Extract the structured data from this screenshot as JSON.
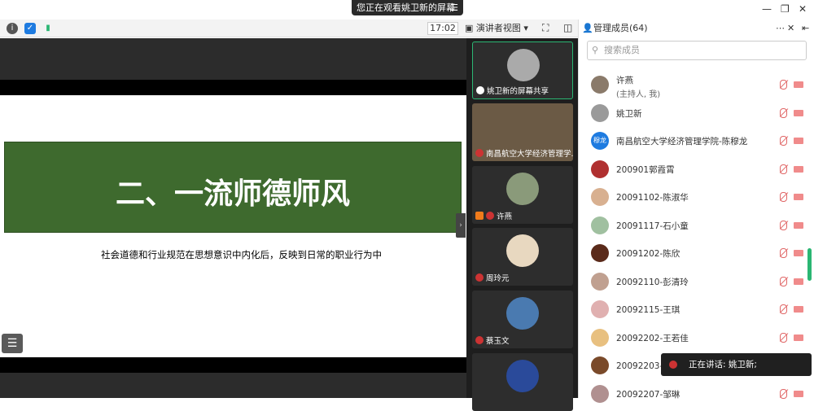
{
  "share_bar": {
    "text": "您正在观看姚卫新的屏幕",
    "menu_icon": "menu-icon"
  },
  "toolbar": {
    "time": "17:02",
    "view_mode": "演讲者视图"
  },
  "slide": {
    "title": "二、一流师德师风",
    "subtitle": "社会道德和行业规范在思想意识中内化后，反映到日常的职业行为中",
    "title_bg": "#3e6a2e"
  },
  "video_tiles": [
    {
      "label": "姚卫新的屏幕共享"
    },
    {
      "label": "南昌航空大学经济管理学..."
    },
    {
      "label": "许燕"
    },
    {
      "label": "周玲元"
    },
    {
      "label": "蔡玉文"
    }
  ],
  "panel": {
    "title": "管理成员(64)",
    "search_placeholder": "搜索成员",
    "members": [
      {
        "name": "许燕",
        "role": "(主持人, 我)",
        "avatar_color": "#8a7a6a"
      },
      {
        "name": "姚卫新",
        "role": "",
        "avatar_color": "#9a9a9a"
      },
      {
        "name": "南昌航空大学经济管理学院-陈穆龙",
        "role": "",
        "avatar_color": "#1e7be0",
        "avatar_text": "穆龙"
      },
      {
        "name": "200901郭霞霄",
        "role": "",
        "avatar_color": "#b03030"
      },
      {
        "name": "20091102-陈淑华",
        "role": "",
        "avatar_color": "#d8b090"
      },
      {
        "name": "20091117-石小童",
        "role": "",
        "avatar_color": "#a0c0a0"
      },
      {
        "name": "20091202-陈欣",
        "role": "",
        "avatar_color": "#5a2a1a"
      },
      {
        "name": "20092110-彭清玲",
        "role": "",
        "avatar_color": "#c0a090"
      },
      {
        "name": "20092115-王琪",
        "role": "",
        "avatar_color": "#e0b0b0"
      },
      {
        "name": "20092202-王若佳",
        "role": "",
        "avatar_color": "#e8c080"
      },
      {
        "name": "20092203-程",
        "role": "",
        "avatar_color": "#7a4a2a"
      },
      {
        "name": "20092207-邹琳",
        "role": "",
        "avatar_color": "#b09090"
      }
    ]
  },
  "speaking": "正在讲话: 姚卫新;",
  "colors": {
    "accent": "#2bb673",
    "muted_red": "#e06666"
  }
}
